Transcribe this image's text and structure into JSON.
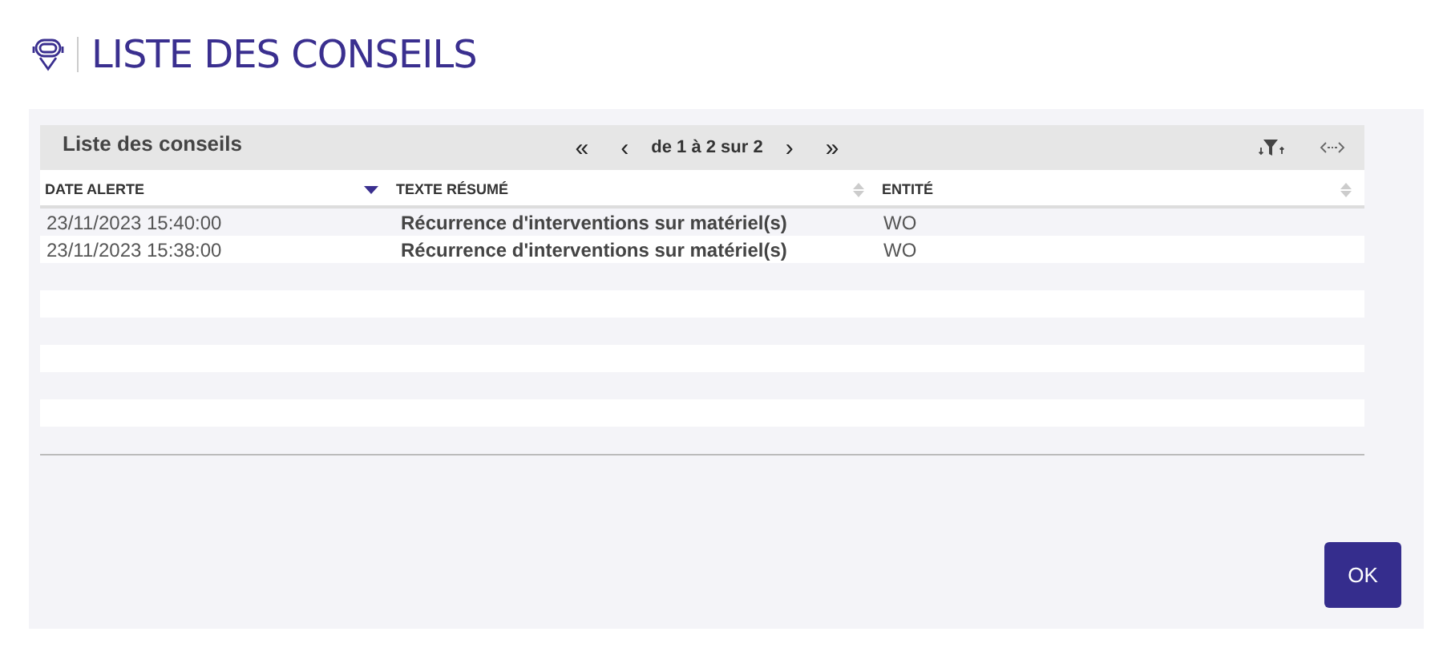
{
  "title": "LISTE DES CONSEILS",
  "grid": {
    "caption": "Liste des conseils",
    "pager": {
      "first": "«",
      "prev": "‹",
      "info": "de 1 à 2 sur  2",
      "next": "›",
      "last": "»"
    },
    "columns": [
      {
        "label": "DATE ALERTE",
        "sorted": true
      },
      {
        "label": "TEXTE RÉSUMÉ",
        "sorted": false
      },
      {
        "label": "ENTITÉ",
        "sorted": false
      }
    ],
    "rows": [
      [
        "23/11/2023 15:40:00",
        "Récurrence d'interventions sur matériel(s)",
        "WO"
      ],
      [
        "23/11/2023 15:38:00",
        "Récurrence d'interventions sur matériel(s)",
        "WO"
      ]
    ]
  },
  "ok_button": "OK"
}
